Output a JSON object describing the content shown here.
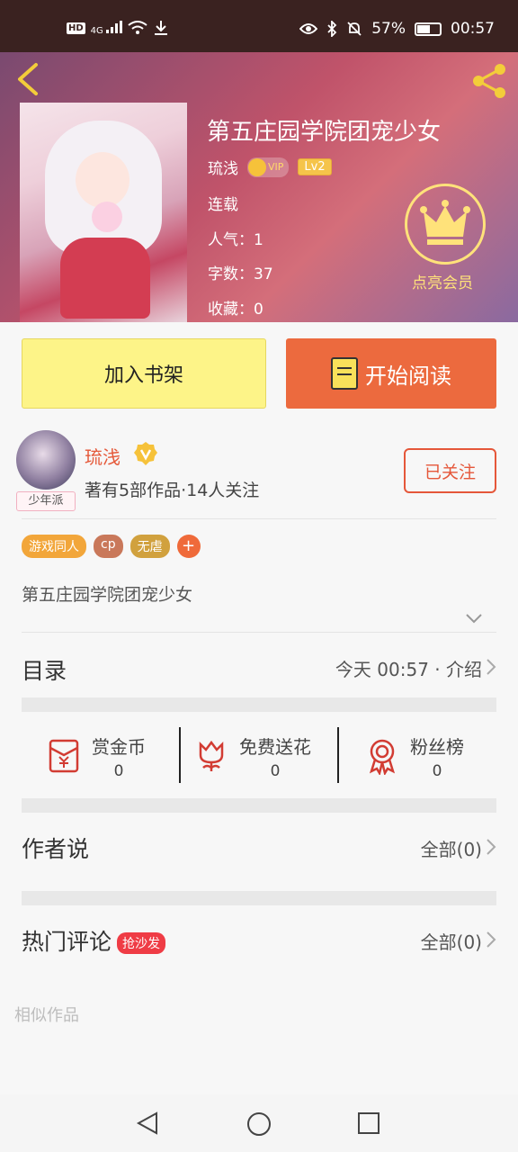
{
  "status_bar": {
    "net": "HD",
    "signal": "4G",
    "battery": "57%",
    "time": "00:57"
  },
  "book": {
    "title": "第五庄园学院团宠少女",
    "author": "琉浅",
    "vip_label": "VIP",
    "level": "Lv2",
    "status": "连载",
    "popularity": "人气：1",
    "word_count": "字数：37",
    "favorites": "收藏：0",
    "member_label": "点亮会员"
  },
  "actions": {
    "add_shelf": "加入书架",
    "start_reading": "开始阅读"
  },
  "author_card": {
    "name": "琉浅",
    "badge": "少年派",
    "stats": "著有5部作品·14人关注",
    "follow_label": "已关注"
  },
  "tags": [
    {
      "label": "游戏同人",
      "color": "#f2a63a"
    },
    {
      "label": "cp",
      "color": "#c9785a"
    },
    {
      "label": "无虐",
      "color": "#d1a13e"
    },
    {
      "label": "+",
      "color": "#ef6a3a"
    }
  ],
  "intro": "第五庄园学院团宠少女",
  "catalog": {
    "title": "目录",
    "meta": "今天 00:57 · 介绍"
  },
  "rewards": [
    {
      "label": "赏金币",
      "count": "0",
      "icon": "red-envelope-icon"
    },
    {
      "label": "免费送花",
      "count": "0",
      "icon": "flower-icon"
    },
    {
      "label": "粉丝榜",
      "count": "0",
      "icon": "medal-icon"
    }
  ],
  "author_says": {
    "title": "作者说",
    "link": "全部(0)"
  },
  "hot_comments": {
    "title": "热门评论",
    "badge": "抢沙发",
    "link": "全部(0)"
  },
  "similar": {
    "title": "相似作品"
  },
  "colors": {
    "accent": "#ec6a3e",
    "shelf_button": "#fdf488",
    "crown": "#ffe27a"
  }
}
